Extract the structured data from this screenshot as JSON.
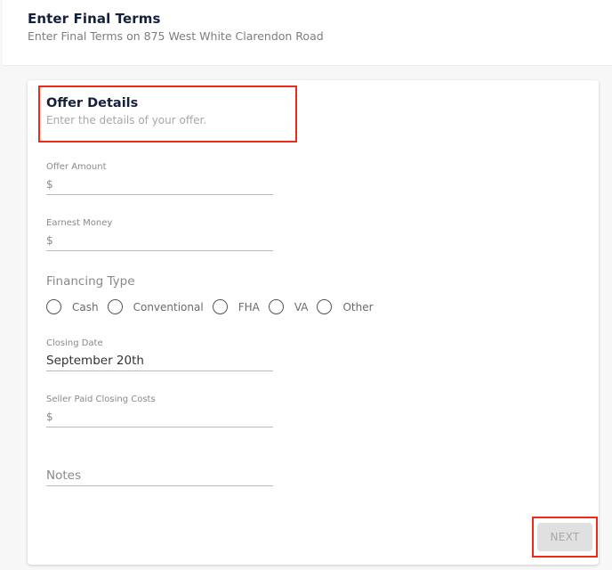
{
  "header": {
    "title": "Enter Final Terms",
    "subtitle": "Enter Final Terms on 875 West White Clarendon Road"
  },
  "card": {
    "title": "Offer Details",
    "subtitle": "Enter the details of your offer.",
    "fields": {
      "offer_amount": {
        "label": "Offer Amount",
        "value": "$"
      },
      "earnest_money": {
        "label": "Earnest Money",
        "value": "$"
      },
      "closing_date": {
        "label": "Closing Date",
        "value": "September 20th"
      },
      "seller_paid": {
        "label": "Seller Paid Closing Costs",
        "value": "$"
      },
      "notes": {
        "placeholder": "Notes",
        "value": ""
      }
    },
    "financing": {
      "label": "Financing Type",
      "options": [
        "Cash",
        "Conventional",
        "FHA",
        "VA",
        "Other"
      ],
      "selected": null
    },
    "next_label": "NEXT"
  },
  "colors": {
    "title": "#14213d",
    "highlight": "#ee2a1b",
    "disabled_button": "#e0e0e0"
  }
}
